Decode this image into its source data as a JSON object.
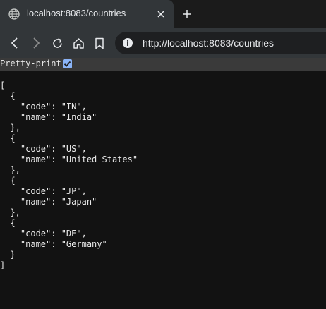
{
  "browser": {
    "tab": {
      "title": "localhost:8083/countries",
      "favicon_icon": "globe-icon",
      "close_icon": "close-icon"
    },
    "new_tab_icon": "plus-icon",
    "toolbar": {
      "back_icon": "back-arrow-icon",
      "forward_icon": "forward-arrow-icon",
      "reload_icon": "reload-icon",
      "home_icon": "home-icon",
      "bookmark_icon": "bookmark-icon",
      "site_info_icon": "info-icon",
      "url": "http://localhost:8083/countries"
    }
  },
  "viewer": {
    "pretty_print_label": "Pretty-print",
    "pretty_print_checked": true
  },
  "json_text": "[\n  {\n    \"code\": \"IN\",\n    \"name\": \"India\"\n  },\n  {\n    \"code\": \"US\",\n    \"name\": \"United States\"\n  },\n  {\n    \"code\": \"JP\",\n    \"name\": \"Japan\"\n  },\n  {\n    \"code\": \"DE\",\n    \"name\": \"Germany\"\n  }\n]",
  "colors": {
    "tab_active": "#323639",
    "tab_strip": "#1b1b1b",
    "omnibox": "#1e1f21",
    "page_bg": "#121212",
    "checkbox_accent": "#8ab4f8"
  }
}
